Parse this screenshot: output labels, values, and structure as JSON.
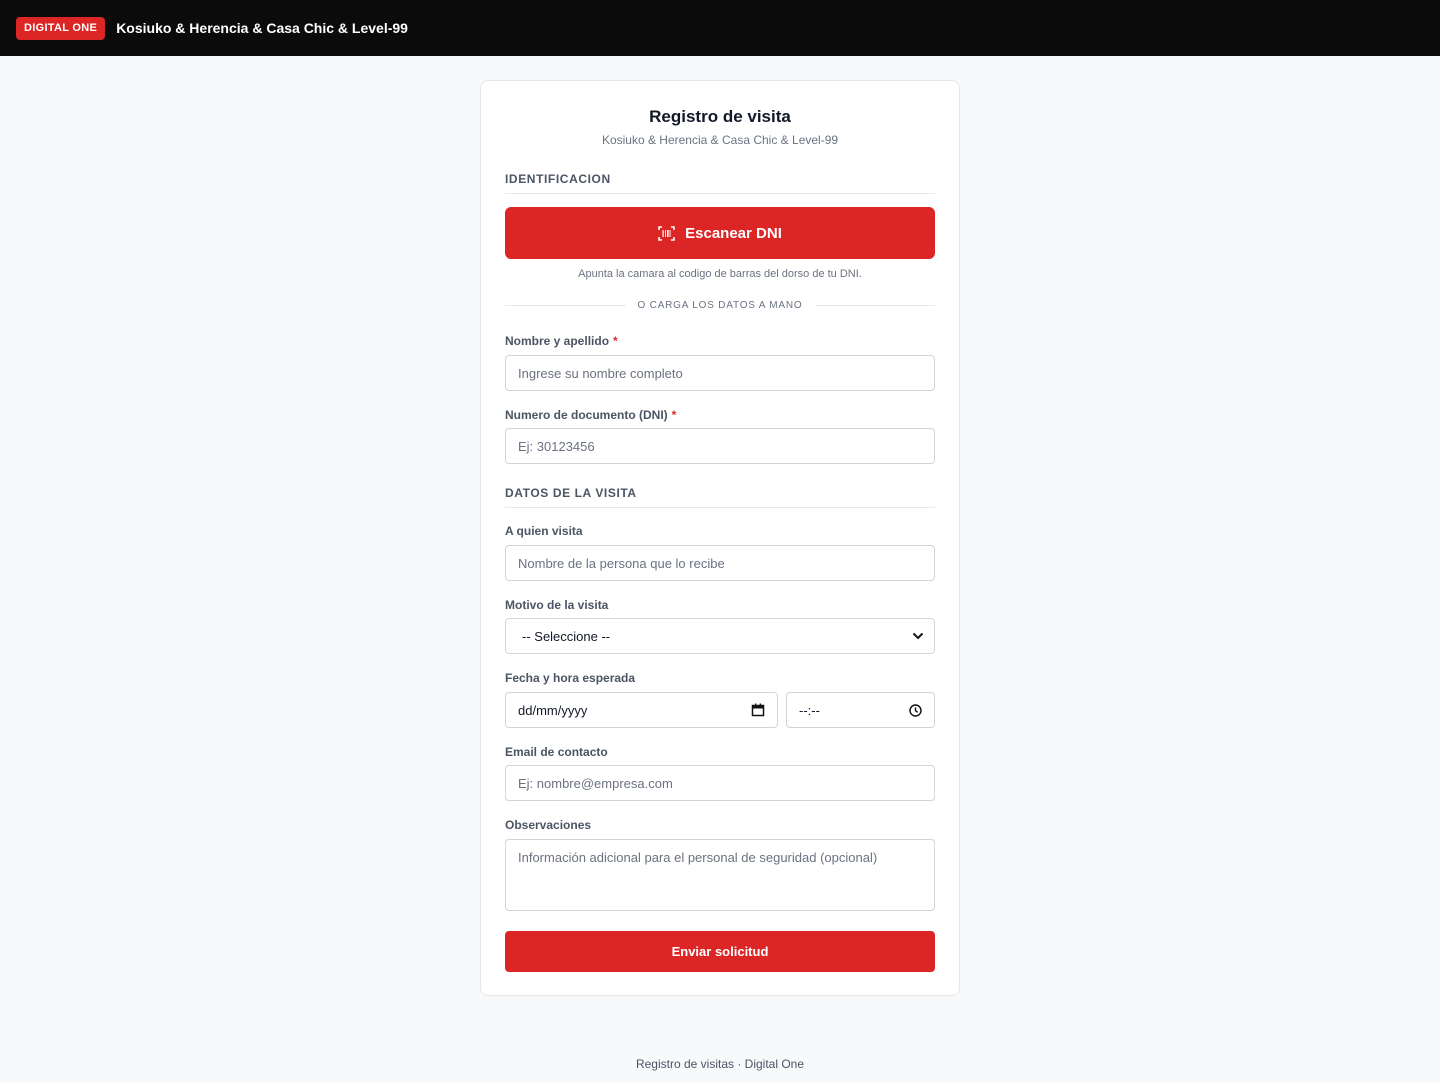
{
  "header": {
    "badge": "DIGITAL ONE",
    "title": "Kosiuko & Herencia & Casa Chic & Level-99"
  },
  "form": {
    "title": "Registro de visita",
    "subtitle": "Kosiuko & Herencia & Casa Chic & Level-99",
    "section_identification": "IDENTIFICACION",
    "scan_button": "Escanear DNI",
    "scan_hint": "Apunta la camara al codigo de barras del dorso de tu DNI.",
    "divider_text": "O CARGA LOS DATOS A MANO",
    "name": {
      "label": "Nombre y apellido",
      "required_mark": "*",
      "placeholder": "Ingrese su nombre completo",
      "value": ""
    },
    "dni": {
      "label": "Numero de documento (DNI)",
      "required_mark": "*",
      "placeholder": "Ej: 30123456",
      "value": ""
    },
    "section_visit": "DATOS DE LA VISITA",
    "host": {
      "label": "A quien visita",
      "placeholder": "Nombre de la persona que lo recibe",
      "value": ""
    },
    "reason": {
      "label": "Motivo de la visita",
      "selected": "-- Seleccione --"
    },
    "datetime": {
      "label": "Fecha y hora esperada",
      "date_placeholder": "dd/mm/yyyy",
      "time_placeholder": "--:--"
    },
    "email": {
      "label": "Email de contacto",
      "placeholder": "Ej: nombre@empresa.com",
      "value": ""
    },
    "notes": {
      "label": "Observaciones",
      "placeholder": "Información adicional para el personal de seguridad (opcional)",
      "value": ""
    },
    "submit_button": "Enviar solicitud"
  },
  "footer": {
    "text": "Registro de visitas · Digital One"
  },
  "colors": {
    "accent": "#dc2626",
    "topbar": "#0b0b0b",
    "background": "#f8f9fb"
  },
  "icons": {
    "scan": "barcode-scan-icon",
    "select": "chevron-down-icon",
    "date": "calendar-icon",
    "time": "clock-icon"
  }
}
